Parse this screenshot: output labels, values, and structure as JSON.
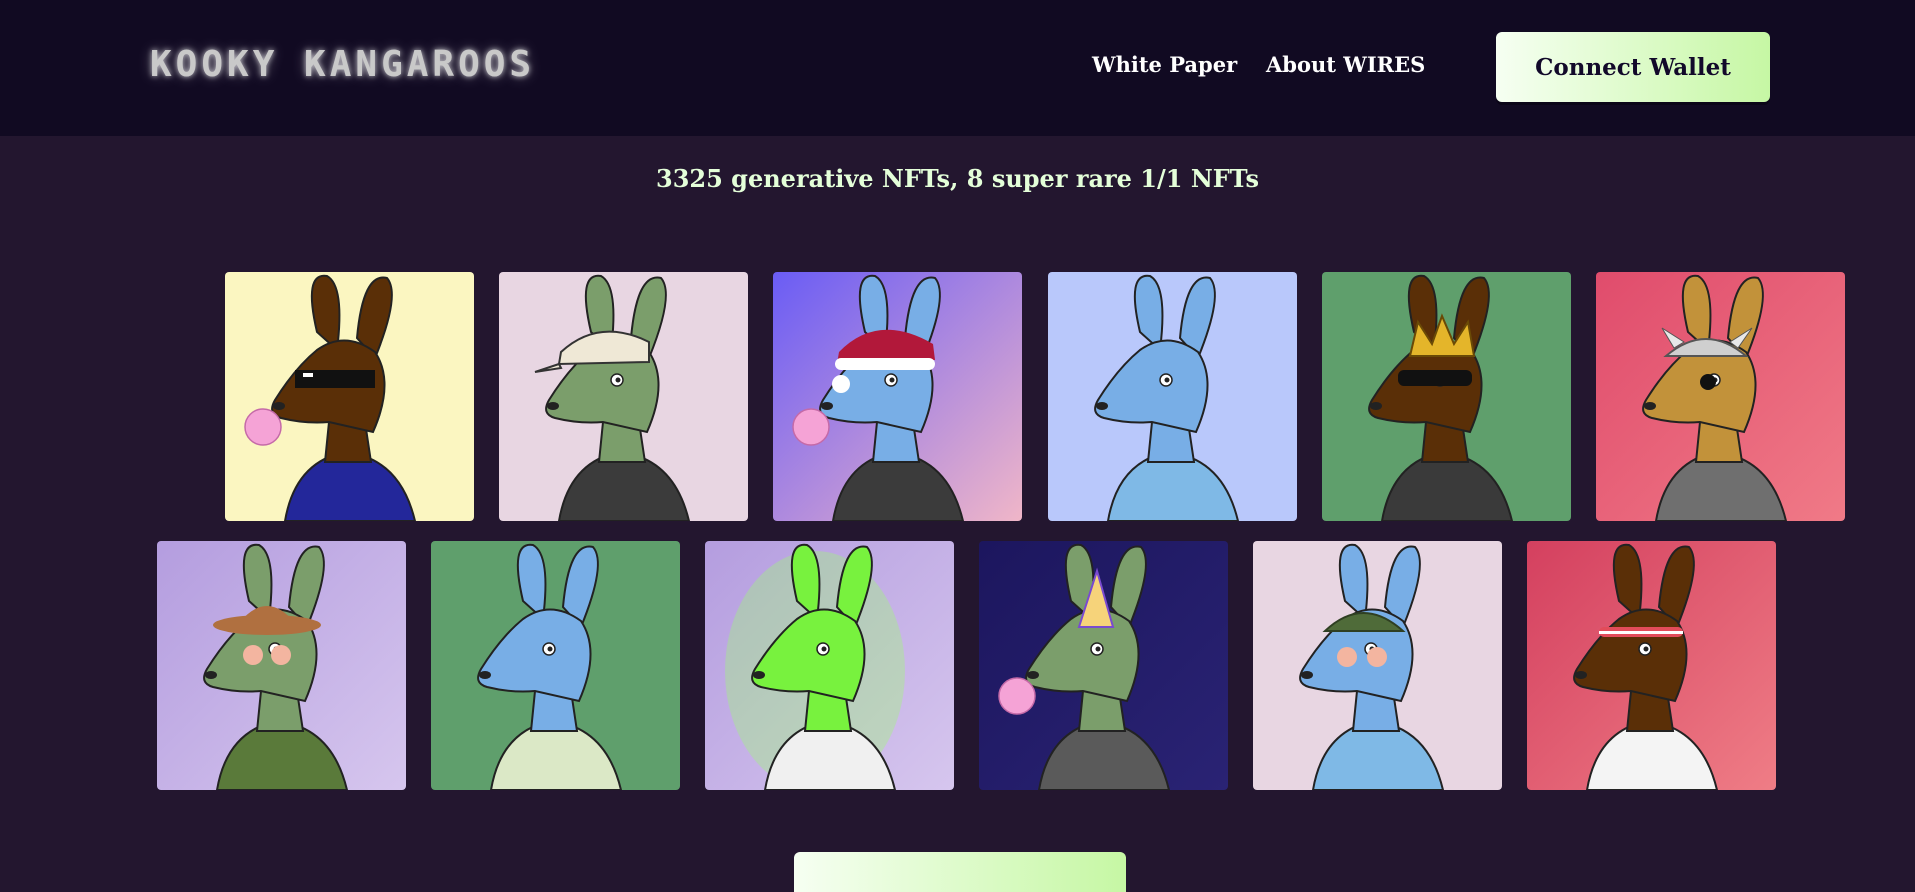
{
  "header": {
    "logo_text": "KOOKY KANGAROOS",
    "nav": [
      {
        "label": "White Paper"
      },
      {
        "label": "About WIRES"
      }
    ],
    "connect_label": "Connect Wallet"
  },
  "main": {
    "subtitle": "3325 generative NFTs, 8 super rare 1/1 NFTs"
  },
  "nfts": [
    {
      "bg": [
        "#fbf6c1",
        "#fbf6c1"
      ],
      "skin": "#5a2f07",
      "shirt": "#23279a",
      "acc": "sunglasses",
      "bubble": true
    },
    {
      "bg": [
        "#e8d6e2",
        "#e8d6e2"
      ],
      "skin": "#7b9e6b",
      "shirt": "#3b3b3b",
      "acc": "cap",
      "bubble": false
    },
    {
      "bg": [
        "#6a5cf5",
        "#f0b6c8"
      ],
      "skin": "#78aee6",
      "shirt": "#3b3b3b",
      "acc": "santa",
      "bubble": true
    },
    {
      "bg": [
        "#b9c8fb",
        "#b9c8fb"
      ],
      "skin": "#78aee6",
      "shirt": "#7fb9e6",
      "acc": "none",
      "bubble": false
    },
    {
      "bg": [
        "#5f9f6c",
        "#5f9f6c"
      ],
      "skin": "#5a2f07",
      "shirt": "#3a3a3a",
      "acc": "crown",
      "bubble": false
    },
    {
      "bg": [
        "#e04c6c",
        "#f07a87"
      ],
      "skin": "#c2923a",
      "shirt": "#6f6f6f",
      "acc": "helmet",
      "bubble": false
    },
    {
      "bg": [
        "#b49ddf",
        "#d6c6ee"
      ],
      "skin": "#7b9e6b",
      "shirt": "#5a7a3a",
      "acc": "cowboy",
      "bubble": false
    },
    {
      "bg": [
        "#5f9f6c",
        "#5f9f6c"
      ],
      "skin": "#78aee6",
      "shirt": "#dbe8c6",
      "acc": "none",
      "bubble": false
    },
    {
      "bg": [
        "#b49ddf",
        "#d6c6ee"
      ],
      "skin": "#78f23e",
      "shirt": "#f0f0f0",
      "acc": "glow",
      "bubble": false
    },
    {
      "bg": [
        "#1c165e",
        "#2a2374"
      ],
      "skin": "#7b9e6b",
      "shirt": "#5a5a5a",
      "acc": "party",
      "bubble": true
    },
    {
      "bg": [
        "#e8d6e2",
        "#e8d6e2"
      ],
      "skin": "#78aee6",
      "shirt": "#7fb9e6",
      "acc": "army",
      "bubble": false
    },
    {
      "bg": [
        "#d4405f",
        "#ef7d86"
      ],
      "skin": "#5a2f07",
      "shirt": "#f4f4f4",
      "acc": "headband",
      "bubble": false
    }
  ],
  "bottom": {
    "label": ""
  }
}
